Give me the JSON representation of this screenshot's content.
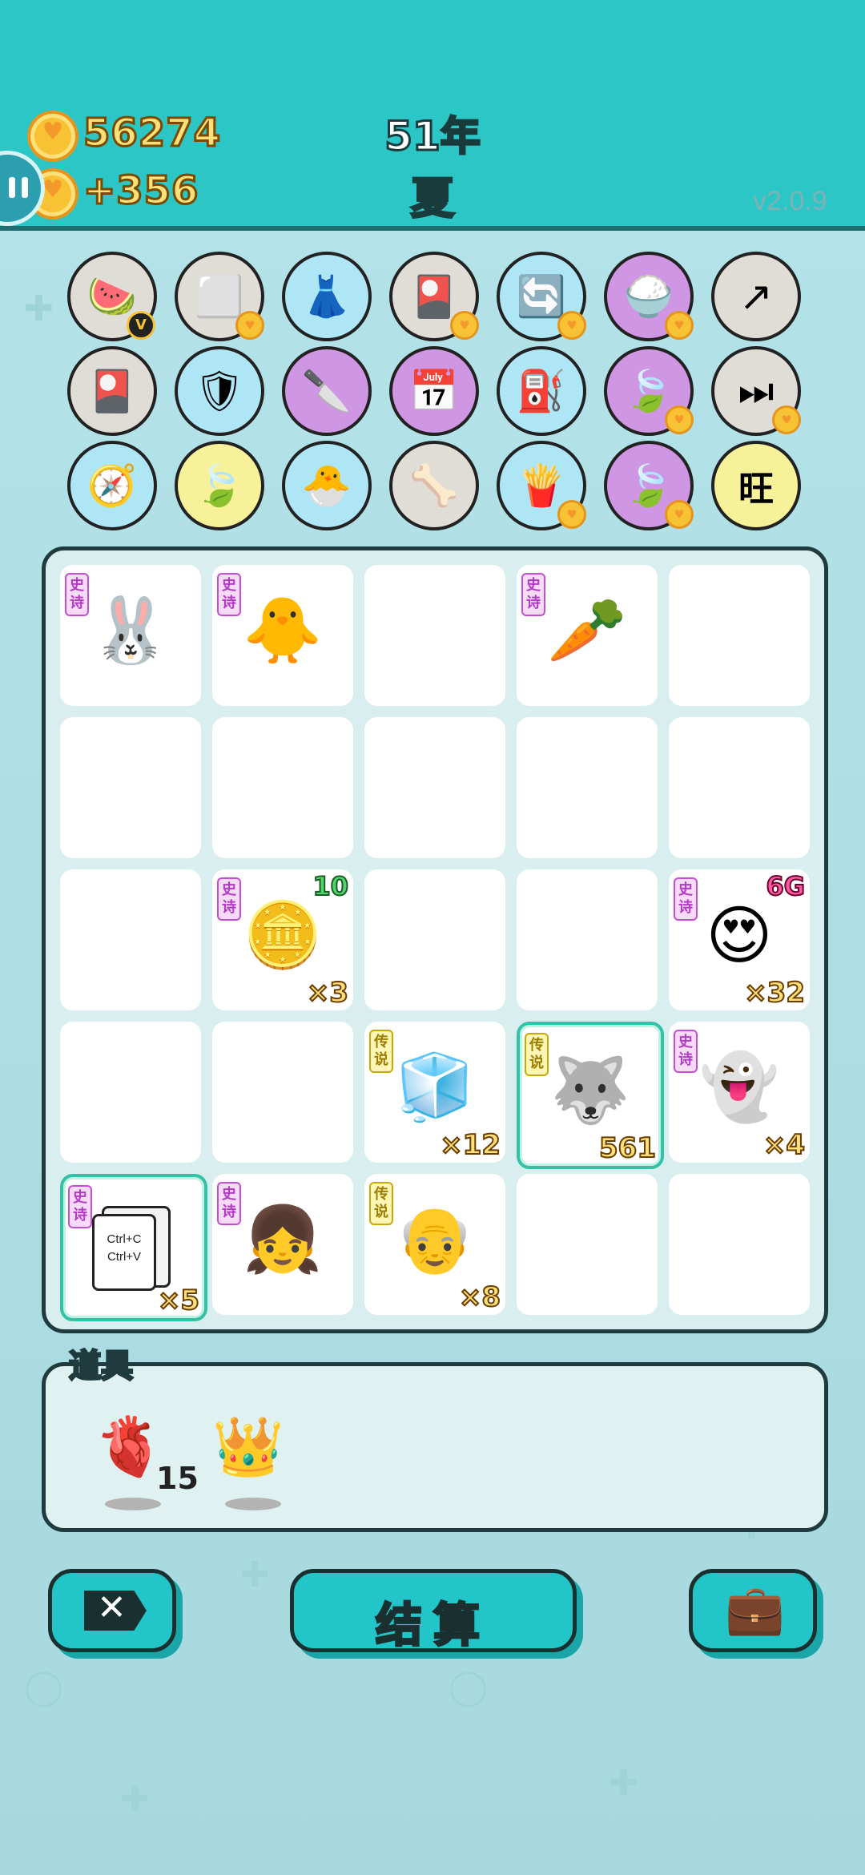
{
  "header": {
    "coins": "56274",
    "income": "+356",
    "year": "51年",
    "season": "夏",
    "version": "v2.0.9"
  },
  "upgrades": [
    {
      "icon": "fruit-platter-icon",
      "glyph": "🍉"
    },
    {
      "icon": "sugar-cubes-icon",
      "glyph": "⬜"
    },
    {
      "icon": "skirt-icon",
      "glyph": "👗"
    },
    {
      "icon": "card-pack-icon",
      "glyph": "🎴"
    },
    {
      "icon": "refresh-icon",
      "glyph": "🔄"
    },
    {
      "icon": "rice-bowl-icon",
      "glyph": "🍚"
    },
    {
      "icon": "arrow-up-card-icon",
      "glyph": "↗"
    },
    {
      "icon": "card-pack-icon",
      "glyph": "🎴"
    },
    {
      "icon": "shield-wrench-icon",
      "glyph": "🛡"
    },
    {
      "icon": "cleaver-icon",
      "glyph": "🔪"
    },
    {
      "icon": "calendar-icon",
      "glyph": "📅"
    },
    {
      "icon": "pump-icon",
      "glyph": "⛽"
    },
    {
      "icon": "leaf-icon",
      "glyph": "🍃"
    },
    {
      "icon": "skip-icon",
      "glyph": "⏭"
    },
    {
      "icon": "compass-icon",
      "glyph": "🧭"
    },
    {
      "icon": "leaf-icon",
      "glyph": "🍃"
    },
    {
      "icon": "chick-egg-icon",
      "glyph": "🐣"
    },
    {
      "icon": "pet-bowl-icon",
      "glyph": "🦴"
    },
    {
      "icon": "fries-icon",
      "glyph": "🍟"
    },
    {
      "icon": "leaf-icon",
      "glyph": "🍃"
    },
    {
      "icon": "wang-tiles-icon",
      "glyph": "旺"
    }
  ],
  "grid": [
    {
      "name": "rabbit-lantern-icon",
      "glyph": "🐰",
      "rarity": "史诗",
      "count": "",
      "top": ""
    },
    {
      "name": "chick-face-icon",
      "glyph": "🐥",
      "rarity": "史诗",
      "count": "",
      "top": ""
    },
    {
      "name": "empty",
      "glyph": "",
      "rarity": "",
      "count": "",
      "top": ""
    },
    {
      "name": "carrot-icon",
      "glyph": "🥕",
      "rarity": "史诗",
      "count": "",
      "top": ""
    },
    {
      "name": "empty",
      "glyph": "",
      "rarity": "",
      "count": "",
      "top": ""
    },
    {
      "name": "empty",
      "glyph": "",
      "rarity": "",
      "count": "",
      "top": ""
    },
    {
      "name": "empty",
      "glyph": "",
      "rarity": "",
      "count": "",
      "top": ""
    },
    {
      "name": "empty",
      "glyph": "",
      "rarity": "",
      "count": "",
      "top": ""
    },
    {
      "name": "empty",
      "glyph": "",
      "rarity": "",
      "count": "",
      "top": ""
    },
    {
      "name": "empty",
      "glyph": "",
      "rarity": "",
      "count": "",
      "top": ""
    },
    {
      "name": "empty",
      "glyph": "",
      "rarity": "",
      "count": "",
      "top": ""
    },
    {
      "name": "coin-pie-icon",
      "glyph": "🪙",
      "rarity": "史诗",
      "count": "×3",
      "top": "10"
    },
    {
      "name": "empty",
      "glyph": "",
      "rarity": "",
      "count": "",
      "top": ""
    },
    {
      "name": "empty",
      "glyph": "",
      "rarity": "",
      "count": "",
      "top": ""
    },
    {
      "name": "gamer-man-icon",
      "glyph": "😍",
      "rarity": "史诗",
      "count": "×32",
      "top": "6G"
    },
    {
      "name": "empty",
      "glyph": "",
      "rarity": "",
      "count": "",
      "top": ""
    },
    {
      "name": "empty",
      "glyph": "",
      "rarity": "",
      "count": "",
      "top": ""
    },
    {
      "name": "fridge-icon",
      "glyph": "🧊",
      "rarity": "传说",
      "count": "×12",
      "top": ""
    },
    {
      "name": "husky-king-icon",
      "glyph": "🐺",
      "rarity": "传说",
      "count": "561",
      "top": ""
    },
    {
      "name": "ghost-icon",
      "glyph": "👻",
      "rarity": "史诗",
      "count": "×4",
      "top": ""
    },
    {
      "name": "copy-paste-icon",
      "glyph": "📄",
      "rarity": "史诗",
      "count": "×5",
      "top": ""
    },
    {
      "name": "girl-braids-icon",
      "glyph": "👧",
      "rarity": "史诗",
      "count": "",
      "top": ""
    },
    {
      "name": "old-man-glasses-icon",
      "glyph": "👴",
      "rarity": "传说",
      "count": "×8",
      "top": ""
    },
    {
      "name": "empty",
      "glyph": "",
      "rarity": "",
      "count": "",
      "top": ""
    },
    {
      "name": "empty",
      "glyph": "",
      "rarity": "",
      "count": "",
      "top": ""
    }
  ],
  "copy_text": {
    "line1": "Ctrl+C",
    "line2": "Ctrl+V"
  },
  "items": {
    "title": "道具",
    "list": [
      {
        "icon": "liver-icon",
        "glyph": "🫀",
        "count": "15"
      },
      {
        "icon": "crown-icon",
        "glyph": "👑",
        "count": ""
      }
    ]
  },
  "buttons": {
    "settle": "结算",
    "close_icon": "close-icon",
    "bag_icon": "briefcase-icon"
  },
  "colors": {
    "header_bg": "#2cc6c7",
    "button_bg": "#22c6c8",
    "epic_tag": "#c34fd4",
    "legend_tag": "#c8a90a"
  }
}
